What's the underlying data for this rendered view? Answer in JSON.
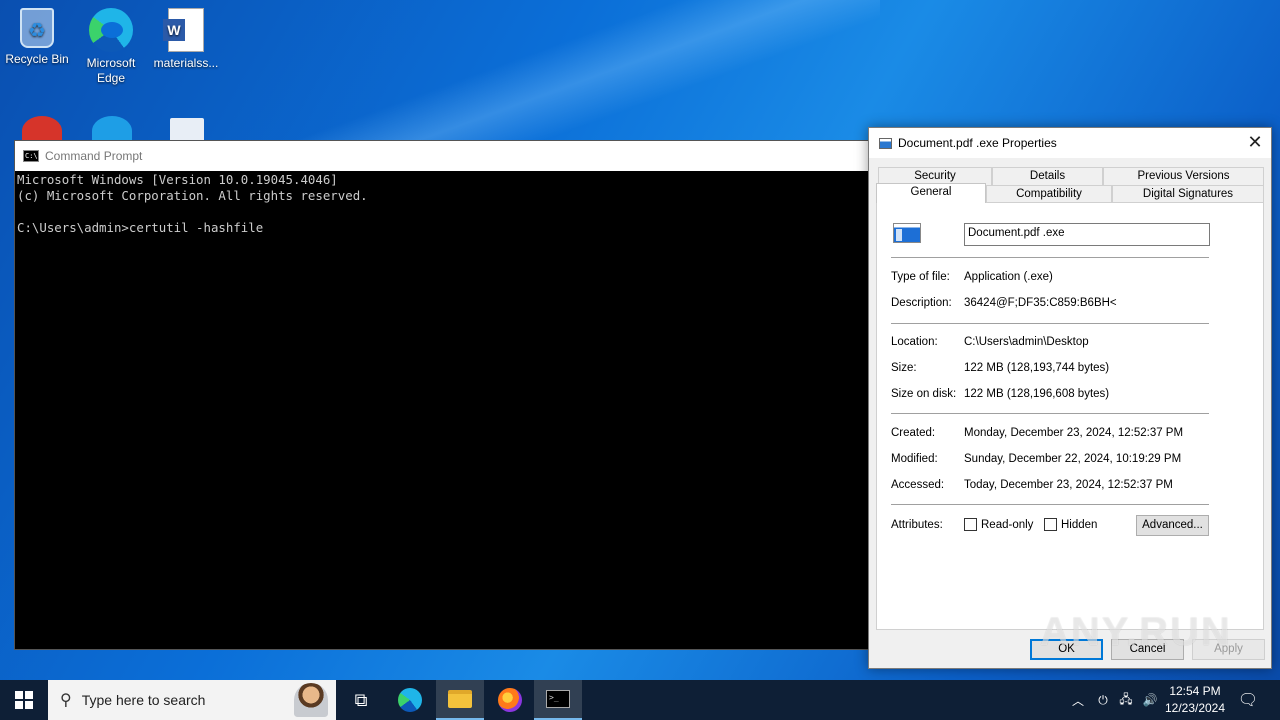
{
  "desktop": {
    "icons": [
      {
        "label": "Recycle Bin"
      },
      {
        "label": "Microsoft Edge"
      },
      {
        "label": "materialss..."
      }
    ]
  },
  "cmd": {
    "title": "Command Prompt",
    "lines": [
      "Microsoft Windows [Version 10.0.19045.4046]",
      "(c) Microsoft Corporation. All rights reserved.",
      "",
      "C:\\Users\\admin>certutil -hashfile"
    ]
  },
  "props": {
    "title": "Document.pdf .exe Properties",
    "tabs_row1": [
      "Security",
      "Details",
      "Previous Versions"
    ],
    "tabs_row2": [
      "General",
      "Compatibility",
      "Digital Signatures"
    ],
    "active_tab": "General",
    "filename": "Document.pdf .exe",
    "type_label": "Type of file:",
    "type_value": "Application (.exe)",
    "desc_label": "Description:",
    "desc_value": "36424@F;DF35:C859:B6BH<",
    "location_label": "Location:",
    "location_value": "C:\\Users\\admin\\Desktop",
    "size_label": "Size:",
    "size_value": "122 MB (128,193,744 bytes)",
    "size_disk_label": "Size on disk:",
    "size_disk_value": "122 MB (128,196,608 bytes)",
    "created_label": "Created:",
    "created_value": "Monday, December 23, 2024, 12:52:37 PM",
    "modified_label": "Modified:",
    "modified_value": "Sunday, December 22, 2024, 10:19:29 PM",
    "accessed_label": "Accessed:",
    "accessed_value": "Today, December 23, 2024, 12:52:37 PM",
    "attributes_label": "Attributes:",
    "readonly_label": "Read-only",
    "hidden_label": "Hidden",
    "advanced_label": "Advanced...",
    "ok_label": "OK",
    "cancel_label": "Cancel",
    "apply_label": "Apply"
  },
  "watermark": "ANY.RUN",
  "taskbar": {
    "search_placeholder": "Type here to search",
    "time": "12:54 PM",
    "date": "12/23/2024"
  }
}
